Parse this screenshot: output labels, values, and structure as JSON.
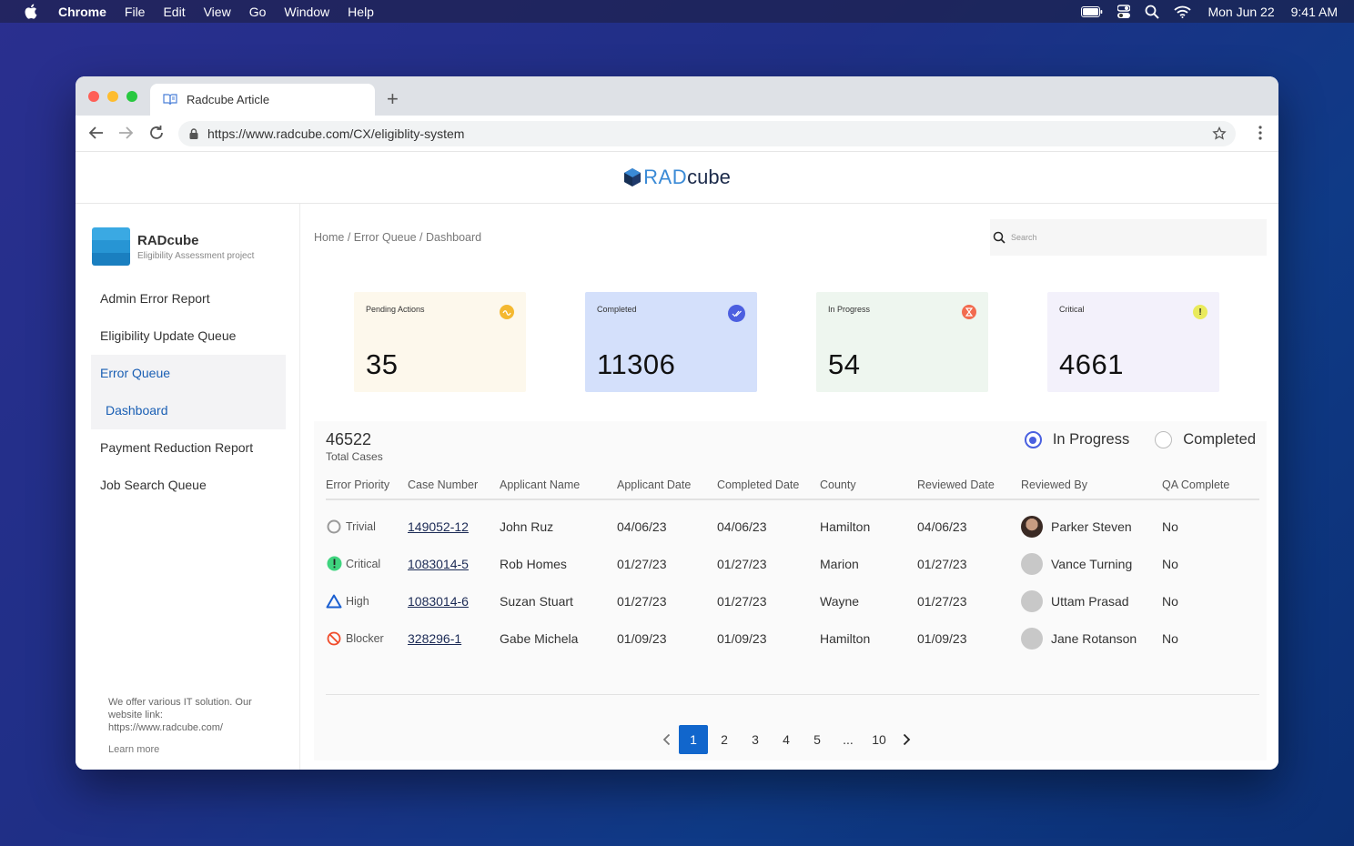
{
  "menubar": {
    "app": "Chrome",
    "items": [
      "File",
      "Edit",
      "View",
      "Go",
      "Window",
      "Help"
    ],
    "date": "Mon Jun 22",
    "time": "9:41 AM"
  },
  "browser": {
    "tab_title": "Radcube Article",
    "url": "https://www.radcube.com/CX/eligiblity-system"
  },
  "brand": {
    "rad": "RAD",
    "cube": "cube"
  },
  "sidebar": {
    "title": "RADcube",
    "subtitle": "Eligibility Assessment project",
    "items": [
      {
        "label": "Admin Error Report"
      },
      {
        "label": "Eligibility Update Queue"
      },
      {
        "label": "Error Queue"
      },
      {
        "label": "Dashboard"
      },
      {
        "label": "Payment Reduction Report"
      },
      {
        "label": "Job Search Queue"
      }
    ],
    "footer_text": "We offer various IT solution. Our website link: https://www.radcube.com/",
    "learn_more": "Learn more"
  },
  "main": {
    "breadcrumb": "Home / Error Queue / Dashboard",
    "search_placeholder": "Search",
    "cards": [
      {
        "label": "Pending Actions",
        "value": "35",
        "bg": "#fdf8ec",
        "icon_color": "#f4b830"
      },
      {
        "label": "Completed",
        "value": "11306",
        "bg": "#d4e0fb",
        "icon_color": "#4c5fe0"
      },
      {
        "label": "In Progress",
        "value": "54",
        "bg": "#eef6ef",
        "icon_color": "#f26b4f"
      },
      {
        "label": "Critical",
        "value": "4661",
        "bg": "#f3f1fb",
        "icon_color": "#e9ea5c"
      }
    ],
    "total_cases": "46522",
    "total_label": "Total Cases",
    "filters": {
      "in_progress": "In Progress",
      "completed": "Completed"
    },
    "columns": [
      "Error Priority",
      "Case Number",
      "Applicant Name",
      "Applicant Date",
      "Completed Date",
      "County",
      "Reviewed Date",
      "Reviewed By",
      "QA Complete"
    ],
    "rows": [
      {
        "priority": "Trivial",
        "case": "149052-12",
        "applicant": "John Ruz",
        "app_date": "04/06/23",
        "comp_date": "04/06/23",
        "county": "Hamilton",
        "rev_date": "04/06/23",
        "reviewer": "Parker Steven",
        "qa": "No"
      },
      {
        "priority": "Critical",
        "case": "1083014-5",
        "applicant": "Rob Homes",
        "app_date": "01/27/23",
        "comp_date": "01/27/23",
        "county": "Marion",
        "rev_date": "01/27/23",
        "reviewer": "Vance Turning",
        "qa": "No"
      },
      {
        "priority": "High",
        "case": "1083014-6",
        "applicant": "Suzan Stuart",
        "app_date": "01/27/23",
        "comp_date": "01/27/23",
        "county": "Wayne",
        "rev_date": "01/27/23",
        "reviewer": "Uttam Prasad",
        "qa": "No"
      },
      {
        "priority": "Blocker",
        "case": "328296-1",
        "applicant": "Gabe Michela",
        "app_date": "01/09/23",
        "comp_date": "01/09/23",
        "county": "Hamilton",
        "rev_date": "01/09/23",
        "reviewer": "Jane Rotanson",
        "qa": "No"
      }
    ],
    "pagination": [
      "1",
      "2",
      "3",
      "4",
      "5",
      "...",
      "10"
    ]
  }
}
